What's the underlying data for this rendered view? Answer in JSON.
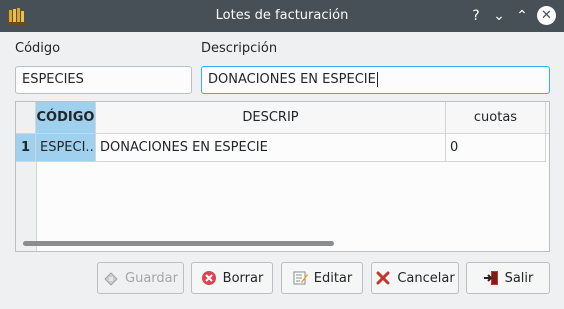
{
  "window": {
    "title": "Lotes de facturación",
    "help_glyph": "?",
    "minimize_glyph": "⌄",
    "maximize_glyph": "⌃",
    "close_glyph": "✕"
  },
  "form": {
    "codigo_label": "Código",
    "codigo_value": "ESPECIES",
    "descripcion_label": "Descripción",
    "descripcion_value": "DONACIONES EN ESPECIE"
  },
  "table": {
    "columns": [
      "CÓDIGO",
      "DESCRIP",
      "cuotas"
    ],
    "rows": [
      {
        "num": "1",
        "codigo": "ESPECI...",
        "descrip": "DONACIONES EN ESPECIE",
        "cuotas": "0"
      }
    ]
  },
  "buttons": {
    "guardar": "Guardar",
    "borrar": "Borrar",
    "editar": "Editar",
    "cancelar": "Cancelar",
    "salir": "Salir"
  },
  "colors": {
    "titlebar": "#475057",
    "selection": "#9fd0ed",
    "focus": "#3daee9"
  }
}
